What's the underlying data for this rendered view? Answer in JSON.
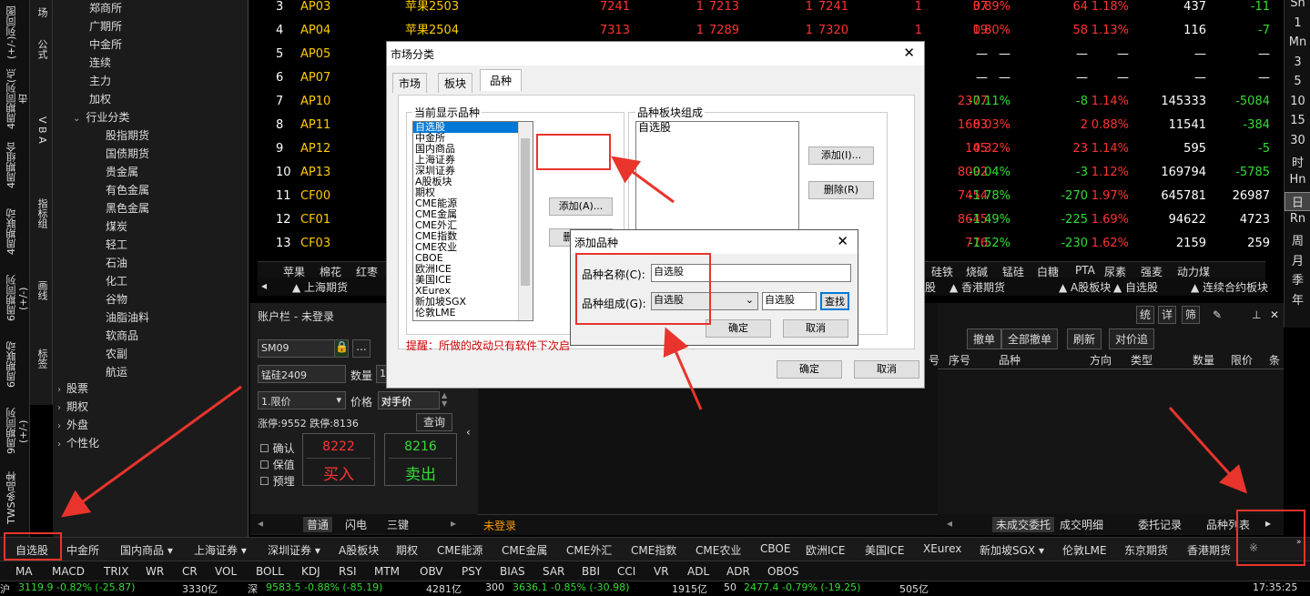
{
  "left_tabs_1": [
    "(+/-)列同图",
    "4周期同列(点击",
    "4周期组合",
    "4周期联动",
    "6周期同列(+/-)",
    "6周期联动",
    "9周期同列(+/-)",
    "TWS多品种"
  ],
  "left_tabs_2": [
    "场",
    "公式",
    "V B A",
    "指标组",
    "画线",
    "标签"
  ],
  "tree": {
    "items": [
      "郑商所",
      "广期所",
      "中金所",
      "连续",
      "主力",
      "加权",
      "行业分类",
      "股指期货",
      "国债期货",
      "贵金属",
      "有色金属",
      "黑色金属",
      "煤炭",
      "轻工",
      "石油",
      "化工",
      "谷物",
      "油脂油料",
      "软商品",
      "农副",
      "航运",
      "股票",
      "期权",
      "外盘",
      "个性化"
    ]
  },
  "quote_rows": [
    {
      "n": "3",
      "code": "AP03",
      "name": "苹果2503",
      "c1": "7241",
      "c2": "1",
      "c3": "7213",
      "c4": "1",
      "c5": "7241",
      "c6": "1",
      "c7": "37",
      "c8": "0.89%",
      "c9": "64",
      "c10": "1.18%",
      "c11": "437",
      "c12": "-11"
    },
    {
      "n": "4",
      "code": "AP04",
      "name": "苹果2504",
      "c1": "7313",
      "c2": "1",
      "c3": "7289",
      "c4": "1",
      "c5": "7320",
      "c6": "1",
      "c7": "19",
      "c8": "0.80%",
      "c9": "58",
      "c10": "1.13%",
      "c11": "116",
      "c12": "-7"
    },
    {
      "n": "5",
      "code": "AP05",
      "name": "",
      "c1": "",
      "c2": "",
      "c3": "",
      "c4": "",
      "c5": "",
      "c6": "",
      "c7": "—",
      "c8": "—",
      "c9": "—",
      "c10": "—",
      "c11": "—",
      "c12": "—"
    },
    {
      "n": "6",
      "code": "AP07",
      "name": "",
      "c1": "",
      "c2": "",
      "c3": "",
      "c4": "",
      "c5": "",
      "c6": "",
      "c7": "—",
      "c8": "—",
      "c9": "—",
      "c10": "—",
      "c11": "—",
      "c12": "—"
    },
    {
      "n": "7",
      "code": "AP10",
      "name": "",
      "c1": "",
      "c2": "",
      "c3": "",
      "c4": "",
      "c5": "",
      "c6": "",
      "c7": "2377",
      "c8": "-0.11%",
      "c9": "-8",
      "c10": "1.14%",
      "c11": "145333",
      "c12": "-5084"
    },
    {
      "n": "8",
      "code": "AP11",
      "name": "",
      "c1": "",
      "c2": "",
      "c3": "",
      "c4": "",
      "c5": "",
      "c6": "",
      "c7": "1683",
      "c8": "0.03%",
      "c9": "2",
      "c10": "0.88%",
      "c11": "11541",
      "c12": "-384"
    },
    {
      "n": "9",
      "code": "AP12",
      "name": "",
      "c1": "",
      "c2": "",
      "c3": "",
      "c4": "",
      "c5": "",
      "c6": "",
      "c7": "145",
      "c8": "0.32%",
      "c9": "23",
      "c10": "1.14%",
      "c11": "595",
      "c12": "-5"
    },
    {
      "n": "10",
      "code": "AP13",
      "name": "",
      "c1": "",
      "c2": "",
      "c3": "",
      "c4": "",
      "c5": "",
      "c6": "",
      "c7": "8092",
      "c8": "-0.04%",
      "c9": "-3",
      "c10": "1.12%",
      "c11": "169794",
      "c12": "-5785"
    },
    {
      "n": "11",
      "code": "CF00",
      "name": "",
      "c1": "",
      "c2": "",
      "c3": "",
      "c4": "",
      "c5": "",
      "c6": "",
      "c7": "7454",
      "c8": "-1.78%",
      "c9": "-270",
      "c10": "1.97%",
      "c11": "645781",
      "c12": "26987"
    },
    {
      "n": "12",
      "code": "CF01",
      "name": "",
      "c1": "",
      "c2": "",
      "c3": "",
      "c4": "",
      "c5": "",
      "c6": "",
      "c7": "8645",
      "c8": "-1.49%",
      "c9": "-225",
      "c10": "1.69%",
      "c11": "94622",
      "c12": "4723"
    },
    {
      "n": "13",
      "code": "CF03",
      "name": "",
      "c1": "",
      "c2": "",
      "c3": "",
      "c4": "",
      "c5": "",
      "c6": "",
      "c7": "776",
      "c8": "-1.52%",
      "c9": "-230",
      "c10": "1.62%",
      "c11": "2159",
      "c12": "259"
    }
  ],
  "right_strip": [
    "Sn",
    "1",
    "Mn",
    "3",
    "5",
    "10",
    "15",
    "30",
    "时",
    "Hn",
    "日",
    "Rn",
    "周",
    "月",
    "季",
    "年"
  ],
  "catbar": [
    "苹果",
    "棉花",
    "红枣",
    "硅铁",
    "烧碱",
    "锰硅",
    "白糖",
    "PTA",
    "尿素",
    "强麦",
    "动力煤"
  ],
  "tabbar": [
    "▲ 上海期货",
    "▲ 香港期货",
    "▲ A股板块",
    "▲ 自选股",
    "▲ 连续合约板块"
  ],
  "tabbar_left": "股",
  "account": {
    "title": "账户栏 - 未登录",
    "code": "SM09",
    "name": "锰硅2409",
    "qty_label": "数量",
    "qty_val": "1",
    "order_type": "1.限价",
    "price_label": "价格",
    "price_val": "对手价",
    "limits": "涨停:9552 跌停:8136",
    "query": "查询",
    "cb1": "确认",
    "cb2": "保值",
    "cb3": "预埋",
    "buy_price": "8222",
    "buy_label": "买入",
    "sell_price": "8216",
    "sell_label": "卖出",
    "tabs": [
      "普通",
      "闪电",
      "三键"
    ],
    "not_logged": "未登录"
  },
  "orders": {
    "buttons": [
      "撤单",
      "全部撤单",
      "刷新",
      "对价追"
    ],
    "headers": [
      "号",
      "序号",
      "品种",
      "方向",
      "类型",
      "数量",
      "限价",
      "条"
    ],
    "tabs": [
      "未成交委托",
      "成交明细",
      "委托记录",
      "品种列表"
    ],
    "toolbar": [
      "统",
      "详",
      "筛"
    ]
  },
  "bottom_list": [
    "自选股",
    "中金所",
    "国内商品 ▾",
    "上海证券 ▾",
    "深圳证券 ▾",
    "A股板块",
    "期权",
    "CME能源",
    "CME金属",
    "CME外汇",
    "CME指数",
    "CME农业",
    "CBOE",
    "欧洲ICE",
    "美国ICE",
    "XEurex",
    "新加坡SGX ▾",
    "伦敦LME",
    "东京期货",
    "香港期货"
  ],
  "indicators": [
    "MA",
    "MACD",
    "TRIX",
    "WR",
    "CR",
    "VOL",
    "BOLL",
    "KDJ",
    "RSI",
    "MTM",
    "OBV",
    "PSY",
    "BIAS",
    "SAR",
    "BBI",
    "CCI",
    "VR",
    "ADL",
    "ADR",
    "OBOS"
  ],
  "status": {
    "s1": "沪",
    "s1v": "3119.9 -0.82% (-25.87)",
    "s1a": "3330亿",
    "s2": "深",
    "s2v": "9583.5 -0.88% (-85.19)",
    "s2a": "4281亿",
    "s3": "300",
    "s3v": "3636.1 -0.85% (-30.98)",
    "s3a": "1915亿",
    "s4": "50",
    "s4v": "2477.4 -0.79% (-19.25)",
    "s4a": "505亿",
    "time": "17:35:25"
  },
  "dialog_market": {
    "title": "市场分类",
    "tabs": [
      "市场",
      "板块",
      "品种"
    ],
    "group1": "当前显示品种",
    "list1": [
      "自选股",
      "中金所",
      "国内商品",
      "上海证券",
      "深圳证券",
      "A股板块",
      "期权",
      "CME能源",
      "CME金属",
      "CME外汇",
      "CME指数",
      "CME农业",
      "CBOE",
      "欧洲ICE",
      "美国ICE",
      "XEurex",
      "新加坡SGX",
      "伦敦LME"
    ],
    "add_btn": "添加(A)...",
    "del_btn": "删除(D)",
    "group2": "品种板块组成",
    "list2": [
      "自选股"
    ],
    "add2_btn": "添加(I)...",
    "del2_btn": "删除(R)",
    "tip": "提醒：所做的改动只有软件下次启",
    "ok": "确定",
    "cancel": "取消"
  },
  "dialog_add": {
    "title": "添加品种",
    "name_label": "品种名称(C):",
    "name_val": "自选股",
    "group_label": "品种组成(G):",
    "group_val": "自选股",
    "search_val": "自选股",
    "search_btn": "查找",
    "ok": "确定",
    "cancel": "取消"
  },
  "colors": {
    "red": "#e8342c",
    "up": "#ff3333",
    "down": "#33dd33",
    "name": "#ffcc00"
  }
}
